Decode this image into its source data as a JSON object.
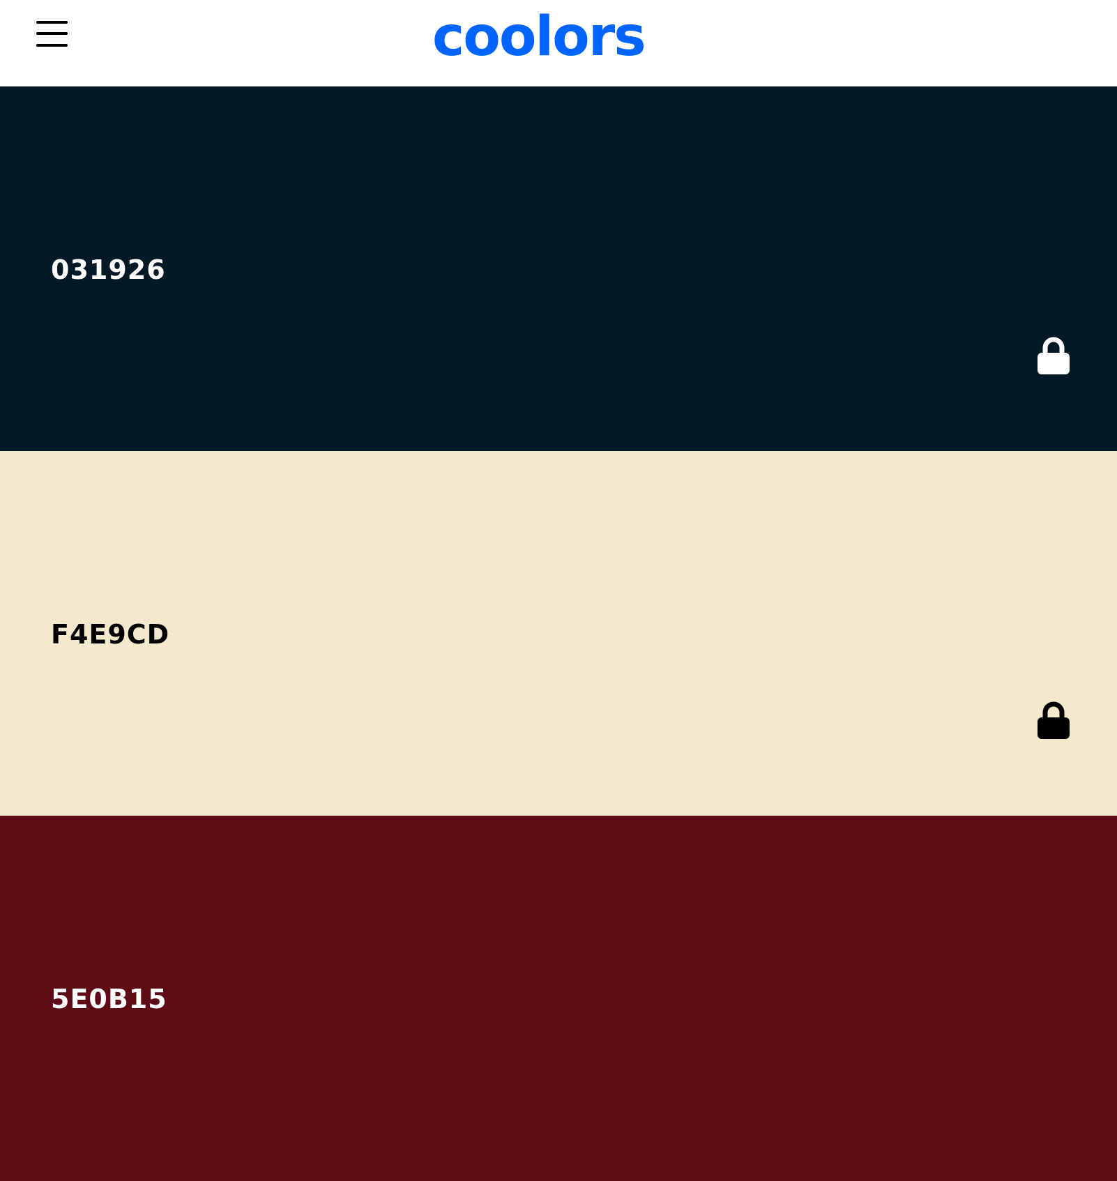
{
  "header": {
    "logo_text": "coolors",
    "logo_color": "#0065FF",
    "menu_icon": "hamburger-menu-icon"
  },
  "palette": {
    "swatches": [
      {
        "hex": "031926",
        "background": "#031926",
        "text_color": "#FFFFFF",
        "lock_icon": "lock-icon",
        "lock_visible": true
      },
      {
        "hex": "F4E9CD",
        "background": "#F4E9CD",
        "text_color": "#000000",
        "lock_icon": "lock-icon",
        "lock_visible": true
      },
      {
        "hex": "5E0B15",
        "background": "#5E0B15",
        "text_color": "#FFFFFF",
        "lock_icon": "lock-icon",
        "lock_visible": false
      }
    ]
  }
}
